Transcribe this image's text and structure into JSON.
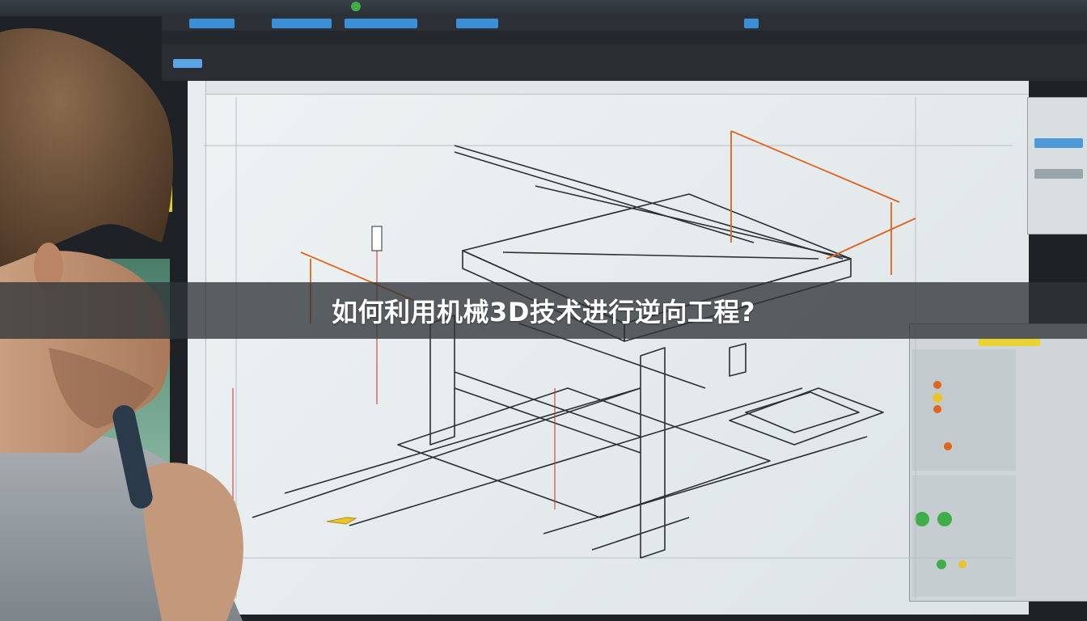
{
  "banner": {
    "title": "如何利用机械3D技术进行逆向工程?"
  },
  "scene": {
    "description_icon": "cad-workstation-photo",
    "accent_colors": {
      "dimension_line": "#e0641c",
      "highlight_yellow": "#e9d330",
      "ui_blue": "#3b8fd6",
      "status_green": "#3fae4a"
    }
  }
}
